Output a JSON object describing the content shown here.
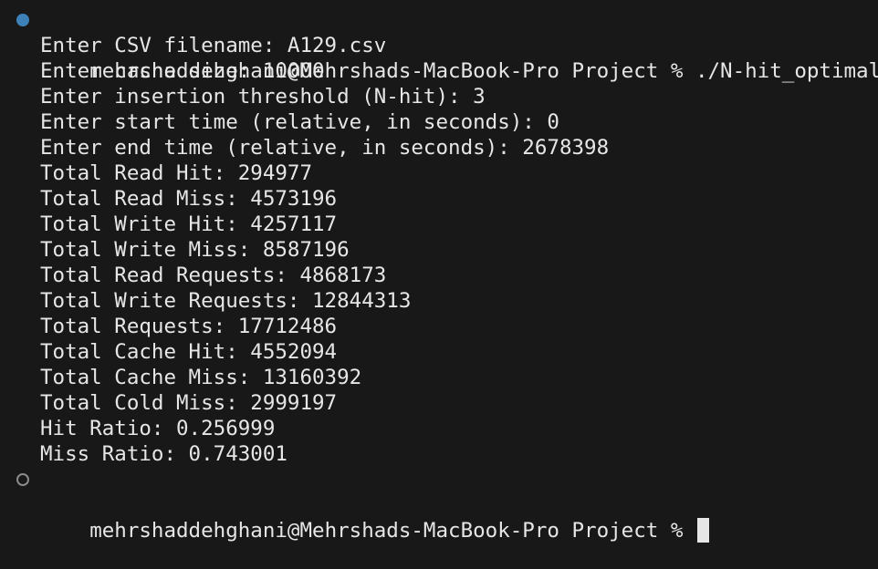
{
  "terminal": {
    "first_prompt": {
      "status": "success",
      "status_color": "#3d81b8",
      "text": "mehrshaddehghani@Mehrshads-MacBook-Pro Project % ./N-hit_optimal"
    },
    "output_lines": [
      "Enter CSV filename: A129.csv",
      "Enter cache size: 10000",
      "Enter insertion threshold (N-hit): 3",
      "Enter start time (relative, in seconds): 0",
      "Enter end time (relative, in seconds): 2678398",
      "Total Read Hit: 294977",
      "Total Read Miss: 4573196",
      "Total Write Hit: 4257117",
      "Total Write Miss: 8587196",
      "Total Read Requests: 4868173",
      "Total Write Requests: 12844313",
      "Total Requests: 17712486",
      "Total Cache Hit: 4552094",
      "Total Cache Miss: 13160392",
      "Total Cold Miss: 2999197",
      "Hit Ratio: 0.256999",
      "Miss Ratio: 0.743001"
    ],
    "second_prompt": {
      "status": "idle",
      "text": "mehrshaddehghani@Mehrshads-MacBook-Pro Project % "
    }
  }
}
